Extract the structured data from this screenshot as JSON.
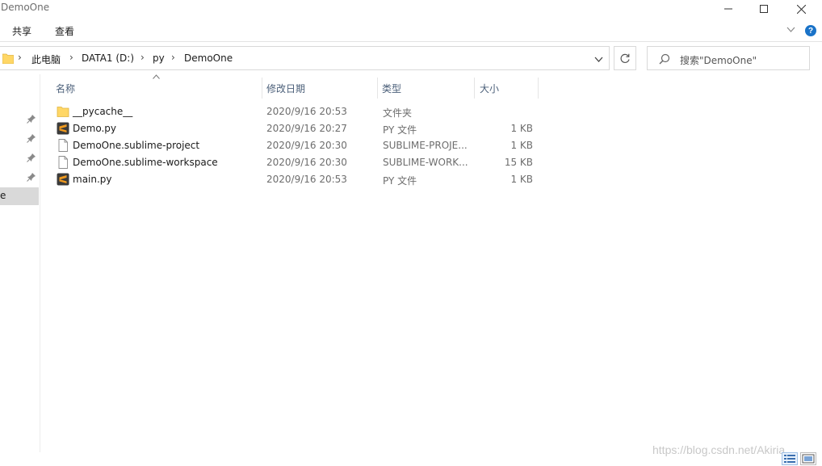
{
  "window": {
    "title": "DemoOne",
    "buttons": {
      "minimize": "minimize",
      "maximize": "maximize",
      "close": "close"
    }
  },
  "ribbon": {
    "tabs": [
      {
        "label": "共享"
      },
      {
        "label": "查看"
      }
    ],
    "help_label": "?"
  },
  "address": {
    "breadcrumbs": [
      "此电脑",
      "DATA1 (D:)",
      "py",
      "DemoOne"
    ]
  },
  "search": {
    "placeholder": "搜索\"DemoOne\""
  },
  "nav": {
    "selected_item_text": "e"
  },
  "columns": {
    "name": "名称",
    "date": "修改日期",
    "type": "类型",
    "size": "大小"
  },
  "files": [
    {
      "name": "__pycache__",
      "date": "2020/9/16 20:53",
      "type": "文件夹",
      "size": "",
      "icon": "folder-icon"
    },
    {
      "name": "Demo.py",
      "date": "2020/9/16 20:27",
      "type": "PY 文件",
      "size": "1 KB",
      "icon": "sublime-file-icon"
    },
    {
      "name": "DemoOne.sublime-project",
      "date": "2020/9/16 20:30",
      "type": "SUBLIME-PROJE...",
      "size": "1 KB",
      "icon": "blank-file-icon"
    },
    {
      "name": "DemoOne.sublime-workspace",
      "date": "2020/9/16 20:30",
      "type": "SUBLIME-WORK...",
      "size": "15 KB",
      "icon": "blank-file-icon"
    },
    {
      "name": "main.py",
      "date": "2020/9/16 20:53",
      "type": "PY 文件",
      "size": "1 KB",
      "icon": "sublime-file-icon"
    }
  ],
  "watermark": "https://blog.csdn.net/Akiria",
  "colors": {
    "folder": "#ffd766",
    "help": "#1a73c8",
    "selected_nav": "#d9d9d9",
    "header_text": "#4c607a"
  }
}
